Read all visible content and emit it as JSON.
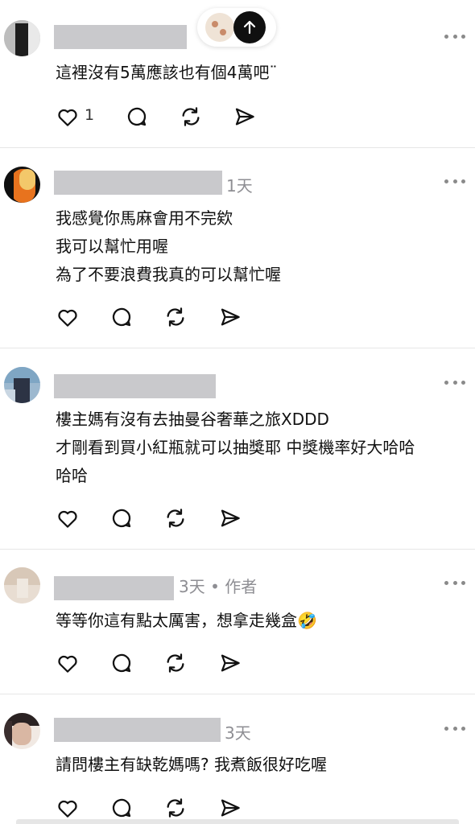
{
  "scroll_to_top": {
    "icon": "arrow-up-icon"
  },
  "comments": [
    {
      "meta": "",
      "lines": [
        "這裡沒有5萬應該也有個4萬吧¨"
      ],
      "like_count": "1"
    },
    {
      "meta": "1天",
      "lines": [
        "我感覺你馬麻會用不完欸",
        "我可以幫忙用喔",
        "為了不要浪費我真的可以幫忙喔"
      ],
      "like_count": ""
    },
    {
      "meta": "",
      "lines": [
        "樓主媽有沒有去抽曼谷奢華之旅XDDD",
        "才剛看到買小紅瓶就可以抽獎耶 中獎機率好大哈哈",
        "哈哈"
      ],
      "like_count": ""
    },
    {
      "meta": "3天 • 作者",
      "lines": [
        "等等你這有點太厲害，想拿走幾盒🤣"
      ],
      "like_count": ""
    },
    {
      "meta": "3天",
      "lines": [
        "請問樓主有缺乾媽嗎? 我煮飯很好吃喔"
      ],
      "like_count": ""
    }
  ]
}
